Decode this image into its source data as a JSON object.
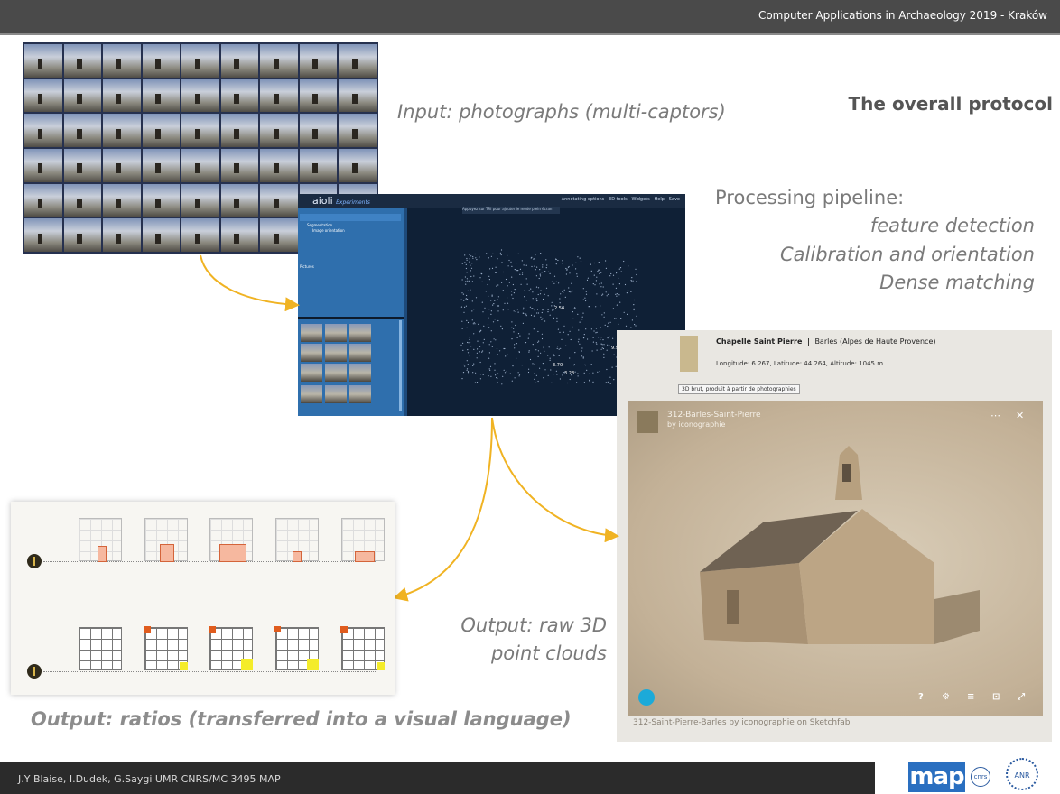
{
  "header": {
    "conference": "Computer Applications in Archaeology  2019 - Kraków"
  },
  "slide": {
    "title": "The overall protocol",
    "input_caption": "Input: photographs (multi-captors)",
    "pipeline": {
      "heading": "Processing pipeline:",
      "steps": [
        "feature detection",
        "Calibration and orientation",
        "Dense matching"
      ]
    },
    "output_pointclouds": [
      "Output: raw 3D",
      "point clouds"
    ],
    "output_ratios": "Output: ratios (transferred into a visual language)"
  },
  "aioli": {
    "logo": "aioli",
    "logo_sub": "Experiments",
    "menu": [
      "Annotating options",
      "3D tools",
      "Widgets",
      "Help",
      "Save"
    ],
    "hint": "Appuyez sur  TRI  pour ajouter le mode plein écran",
    "panel_tabs": [
      "Segmentation",
      "Image orientation"
    ],
    "panel_label": "Pictures",
    "measures": [
      "2.54",
      "9.96",
      "3.70",
      "3.23"
    ]
  },
  "sketchfab": {
    "title": "Chapelle Saint Pierre",
    "location": "Barles (Alpes de Haute Provence)",
    "coords": "Longitude: 6.267, Latitude: 44.264, Altitude: 1045 m",
    "note": "3D brut, produit à partir de photographies",
    "model_name": "312-Barles-Saint-Pierre",
    "model_by": "by iconographie",
    "footer": "312-Saint-Pierre-Barles by iconographie on Sketchfab",
    "controls": [
      "?",
      "⚙",
      "≡",
      "⊡",
      "⤢"
    ]
  },
  "footer": {
    "authors": "J.Y Blaise, I.Dudek, G.Saygi UMR CNRS/MC 3495 MAP",
    "logos": [
      "map",
      "cnrs",
      "ANR"
    ]
  },
  "colors": {
    "accent_arrow": "#f0b323",
    "header_bg": "#4a4a4a",
    "footer_bg": "#2b2b2b",
    "ratio_orange": "#e05c1e",
    "ratio_yellow": "#f4ec2a"
  }
}
